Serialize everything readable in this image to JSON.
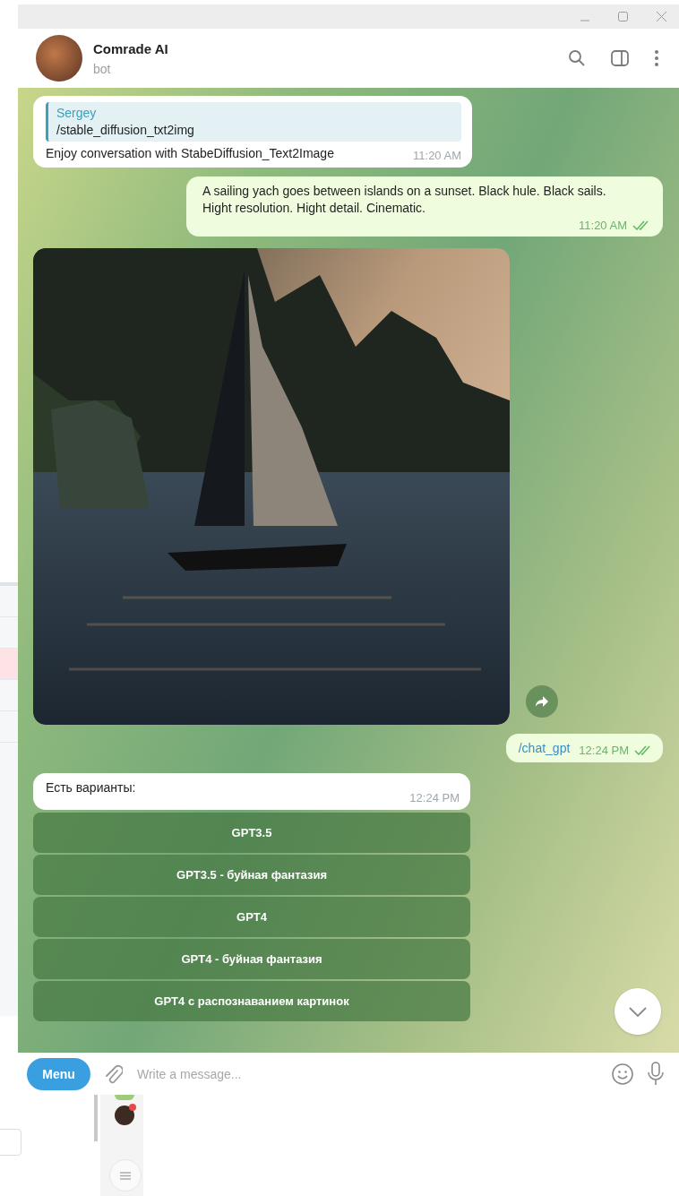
{
  "chat": {
    "name": "Comrade AI",
    "status": "bot"
  },
  "messages": [
    {
      "kind": "text",
      "outgoing": false,
      "reply": {
        "author": "Sergey",
        "text": "/stable_diffusion_txt2img"
      },
      "text": "Enjoy conversation with StabeDiffusion_Text2Image",
      "time": "11:20 AM"
    },
    {
      "kind": "text",
      "outgoing": true,
      "text": "A sailing yach goes between islands on a sunset. Black hule. Black sails. Hight resolution. Hight detail. Cinematic.",
      "time": "11:20 AM",
      "read": true
    },
    {
      "kind": "photo",
      "outgoing": false
    },
    {
      "kind": "command",
      "outgoing": true,
      "text": "/chat_gpt",
      "time": "12:24 PM",
      "read": true
    },
    {
      "kind": "text",
      "outgoing": false,
      "text": "Есть варианты:",
      "time": "12:24 PM",
      "buttons": [
        "GPT3.5",
        "GPT3.5 - буйная фантазия",
        "GPT4",
        "GPT4 - буйная фантазия",
        "GPT4 с распознаванием картинок"
      ]
    }
  ],
  "composer": {
    "menu_label": "Menu",
    "placeholder": "Write a message..."
  }
}
